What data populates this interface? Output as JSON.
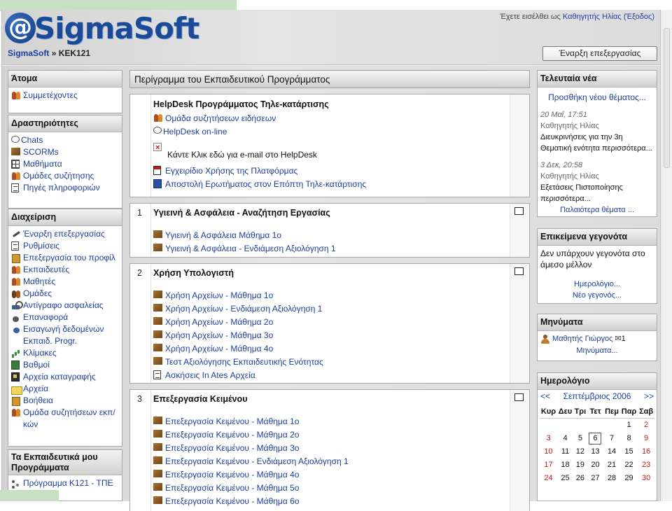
{
  "header": {
    "logo_at": "@",
    "logo_text": "SigmaSoft",
    "login_prefix": "Έχετε εισέλθει ως",
    "login_user": "Καθηγητής Ηλίας",
    "logout_label": "(Έξοδος)"
  },
  "navbar": {
    "home": "SigmaSoft",
    "separator": "»",
    "course": "ΚΕΚ121",
    "edit_button": "Έναρξη επεξεργασίας"
  },
  "left": {
    "people": {
      "title": "Άτομα",
      "items": [
        {
          "label": "Συμμετέχοντες",
          "icon": "people-icon"
        }
      ]
    },
    "activities": {
      "title": "Δραστηριότητες",
      "items": [
        {
          "label": "Chats",
          "icon": "chat-icon"
        },
        {
          "label": "SCORMs",
          "icon": "package-icon"
        },
        {
          "label": "Μαθήματα",
          "icon": "lesson-icon"
        },
        {
          "label": "Ομάδες συζήτησης",
          "icon": "forum-icon"
        },
        {
          "label": "Πηγές πληροφοριών",
          "icon": "resource-icon"
        }
      ]
    },
    "admin": {
      "title": "Διαχείριση",
      "items": [
        {
          "label": "Έναρξη επεξεργασίας",
          "icon": "edit-icon"
        },
        {
          "label": "Ρυθμίσεις",
          "icon": "settings-icon"
        },
        {
          "label": "Επεξεργασία του προφίλ",
          "icon": "profile-icon"
        },
        {
          "label": "Εκπαιδευτές",
          "icon": "teachers-icon"
        },
        {
          "label": "Μαθητές",
          "icon": "students-icon"
        },
        {
          "label": "Ομάδες",
          "icon": "groups-icon"
        },
        {
          "label": "Αντίγραφο ασφαλείας",
          "icon": "backup-icon"
        },
        {
          "label": "Επαναφορά",
          "icon": "restore-icon"
        },
        {
          "label": "Εισαγωγή δεδομένων Εκπαιδ. Progr.",
          "icon": "import-icon"
        },
        {
          "label": "Κλίμακες",
          "icon": "scales-icon"
        },
        {
          "label": "Βαθμοί",
          "icon": "grades-icon"
        },
        {
          "label": "Αρχεία καταγραφής",
          "icon": "logs-icon"
        },
        {
          "label": "Αρχεία",
          "icon": "folder-icon"
        },
        {
          "label": "Βοήθεια",
          "icon": "help-icon"
        },
        {
          "label": "Ομάδα συζητήσεων εκπ/κών",
          "icon": "teacher-forum-icon"
        }
      ]
    },
    "my_courses": {
      "title": "Τα Εκπαιδευτικά μου Προγράμματα",
      "items": [
        {
          "label": "Πρόγραμμα Κ121 - ΤΠΕ",
          "icon": "course-icon"
        }
      ]
    }
  },
  "center": {
    "title": "Περίγραμμα του Εκπαιδευτικού Προγράμματος",
    "section0": {
      "heading": "HelpDesk Προγράμματος Τηλε-κατάρτισης",
      "items": [
        "Ομάδα συζητήσεων ειδήσεων",
        "HelpDesk on-line",
        "Κάντε Κλικ εδώ για e-mail στο HelpDesk",
        "Εγχειρίδιο Χρήσης της Πλατφόρμας",
        "Αποστολή Ερωτήματος στον Επόπτη Τηλε-κατάρτισης"
      ]
    },
    "section1": {
      "number": "1",
      "heading": "Υγιεινή & Ασφάλεια - Αναζήτηση Εργασίας",
      "items": [
        "Υγιεινή & Ασφάλεια Μάθημα 1ο",
        "Υγιεινή & Ασφάλεια - Ενδιάμεση Αξιολόγηση 1"
      ]
    },
    "section2": {
      "number": "2",
      "heading": "Χρήση Υπολογιστή",
      "items": [
        "Χρήση Αρχείων - Μάθημα 1ο",
        "Χρήση Αρχείων - Ενδιάμεση Αξιολόγηση 1",
        "Χρήση Αρχείων - Μάθημα 2ο",
        "Χρήση Αρχείων - Μάθημα 3ο",
        "Χρήση Αρχείων - Μάθημα 4ο",
        "Τεστ Αξιολόγησης Εκπαιδευτικής Ενότητας",
        "Ασκήσεις In Ates Αρχεία"
      ]
    },
    "section3": {
      "number": "3",
      "heading": "Επεξεργασία Κειμένου",
      "items": [
        "Επεξεργασία Κειμένου - Μάθημα 1ο",
        "Επεξεργασία Κειμένου - Μάθημα 2ο",
        "Επεξεργασία Κειμένου - Μάθημα 3ο",
        "Επεξεργασία Κειμένου - Ενδιάμεση Αξιολόγηση 1",
        "Επεξεργασία Κειμένου - Μάθημα 4ο",
        "Επεξεργασία Κειμένου - Μάθημα 5ο",
        "Επεξεργασία Κειμένου - Μάθημα 6ο"
      ]
    }
  },
  "right": {
    "news": {
      "title": "Τελευταία νέα",
      "add_topic": "Προσθήκη νέου θέματος...",
      "posts": [
        {
          "date": "20 Μαΐ, 17:51",
          "author": "Καθηγητής Ηλίας",
          "text": "Διευκρινήσεις για την 3η Θεματική ενότητα περισσότερα..."
        },
        {
          "date": "3 Δεκ, 20:58",
          "author": "Καθηγητής Ηλίας",
          "text": "Εξετάσεις Πιστοποίησης περισσότερα..."
        }
      ],
      "older": "Παλαιότερα θέματα ..."
    },
    "events": {
      "title": "Επικείμενα γεγονότα",
      "text": "Δεν υπάρχουν γεγονότα στο άμεσο μέλλον",
      "calendar_link": "Ημερολόγιο...",
      "new_event": "Νέο γεγονός..."
    },
    "messages": {
      "title": "Μηνύματα",
      "sender": "Μαθητής Γιώργος",
      "count": "1",
      "link": "Μηνύματα..."
    },
    "calendar": {
      "title": "Ημερολόγιο",
      "prev": "<<",
      "month": "Σεπτέμβριος 2006",
      "next": ">>",
      "weekdays": [
        "Κυρ",
        "Δευ",
        "Τρι",
        "Τετ",
        "Πεμ",
        "Παρ",
        "Σαβ"
      ],
      "weeks": [
        [
          "",
          "",
          "",
          "",
          "",
          "1",
          "2"
        ],
        [
          "3",
          "4",
          "5",
          "6",
          "7",
          "8",
          "9"
        ],
        [
          "10",
          "11",
          "12",
          "13",
          "14",
          "15",
          "16"
        ],
        [
          "17",
          "18",
          "19",
          "20",
          "21",
          "22",
          "23"
        ],
        [
          "24",
          "25",
          "26",
          "27",
          "28",
          "29",
          "30"
        ]
      ],
      "today": "6"
    }
  }
}
